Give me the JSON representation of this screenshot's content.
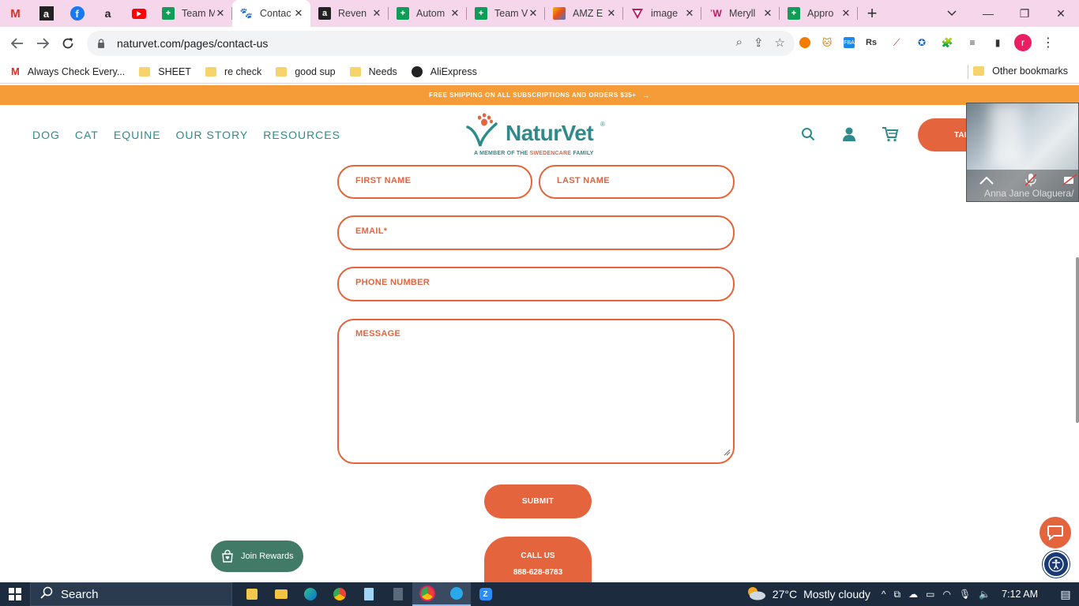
{
  "browser": {
    "pinned_tabs": [
      {
        "icon": "gmail-icon",
        "color": "#d93025"
      },
      {
        "icon": "amazon-icon",
        "color": "#222222"
      },
      {
        "icon": "facebook-icon",
        "color": "#1877f2"
      },
      {
        "icon": "amazon-icon",
        "color": "#ffffff"
      },
      {
        "icon": "youtube-icon",
        "color": "#ff0000"
      }
    ],
    "tabs": [
      {
        "title": "Team M",
        "icon": "sheets-icon"
      },
      {
        "title": "Contac",
        "icon": "paw-icon",
        "active": true
      },
      {
        "title": "Reven",
        "icon": "amazon-icon"
      },
      {
        "title": "Autom",
        "icon": "sheets-icon"
      },
      {
        "title": "Team V",
        "icon": "sheets-icon"
      },
      {
        "title": "AMZ E",
        "icon": "pencil-icon"
      },
      {
        "title": "image",
        "icon": "triangle-icon"
      },
      {
        "title": "Meryll",
        "icon": "ghost-icon"
      },
      {
        "title": "Appro",
        "icon": "sheets-icon"
      }
    ],
    "url": "naturvet.com/pages/contact-us",
    "bookmarks": [
      {
        "label": "Always Check Every...",
        "icon": "gmail-icon"
      },
      {
        "label": "SHEET",
        "icon": "folder-icon"
      },
      {
        "label": "re check",
        "icon": "folder-icon"
      },
      {
        "label": "good sup",
        "icon": "folder-icon"
      },
      {
        "label": "Needs",
        "icon": "folder-icon"
      },
      {
        "label": "AliExpress",
        "icon": "globe-icon"
      }
    ],
    "other_bookmarks": "Other bookmarks",
    "profile_initial": "r"
  },
  "site": {
    "promo": "FREE SHIPPING ON ALL SUBSCRIPTIONS AND ORDERS $35+",
    "nav": [
      "DOG",
      "CAT",
      "EQUINE",
      "OUR STORY",
      "RESOURCES"
    ],
    "logo_name": "NaturVet",
    "logo_tag_prefix": "A MEMBER OF THE ",
    "logo_tag_brand": "SWEDENCARE",
    "logo_tag_suffix": " FAMILY",
    "cta_partial": "TAI",
    "brand_teal": "#2f8a8b",
    "brand_orange": "#e4643e"
  },
  "form": {
    "first_name": "FIRST NAME",
    "last_name": "LAST NAME",
    "email": "EMAIL*",
    "phone": "PHONE NUMBER",
    "message": "MESSAGE",
    "submit": "SUBMIT",
    "call_label": "CALL US",
    "call_number": "888-628-8783"
  },
  "widgets": {
    "rewards": "Join Rewards"
  },
  "video": {
    "participant": "Anna Jane Olaguera/"
  },
  "taskbar": {
    "search": "Search",
    "temperature": "27°C",
    "weather": "Mostly cloudy",
    "time": "7:12 AM"
  }
}
